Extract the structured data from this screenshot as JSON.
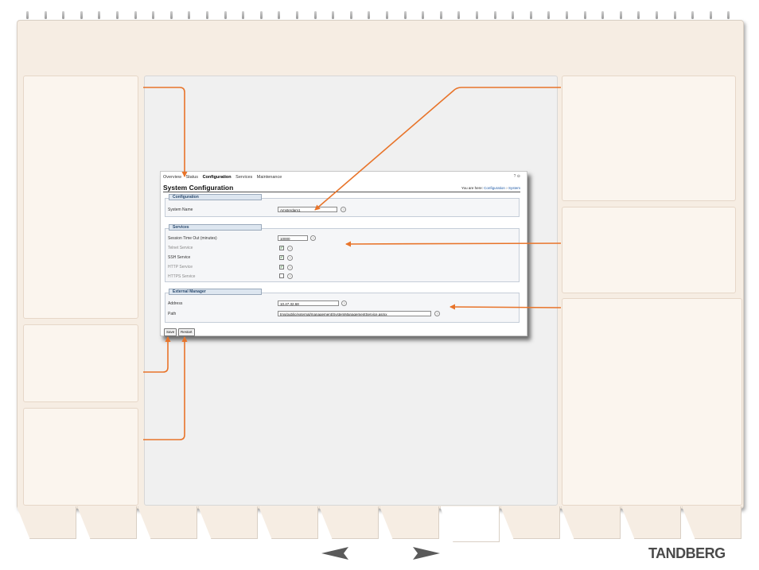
{
  "nav": {
    "items": [
      "Overview",
      "Status",
      "Configuration",
      "Services",
      "Maintenance"
    ],
    "active": "Configuration"
  },
  "page_title": "System Configuration",
  "breadcrumb": {
    "prefix": "You are here:",
    "path1": "Configuration",
    "separator": "›",
    "path2": "System"
  },
  "sections": {
    "configuration": {
      "title": "Configuration",
      "system_name_label": "System Name",
      "system_name_value": "Amsterdam1"
    },
    "services": {
      "title": "Services",
      "session_timeout_label": "Session Time Out (minutes)",
      "session_timeout_value": "10000",
      "telnet_label": "Telnet Service",
      "telnet_checked": true,
      "ssh_label": "SSH Service",
      "ssh_checked": true,
      "http_label": "HTTP Service",
      "http_checked": true,
      "https_label": "HTTPS Service",
      "https_checked": false
    },
    "external_manager": {
      "title": "External Manager",
      "address_label": "Address",
      "address_value": "10.47.32.68",
      "path_label": "Path",
      "path_value": "tms/public/external/management/SystemManagementService.asmx"
    }
  },
  "buttons": {
    "save": "Save",
    "restart": "Restart"
  },
  "brand": "TANDBERG",
  "colors": {
    "accent_orange": "#e8742a",
    "page_background": "#f6ede3",
    "link_blue": "#1f5aa6"
  },
  "icons": {
    "prev": "left-arrow-icon",
    "next": "right-arrow-icon",
    "help": "help-icon",
    "check": "checkmark-icon"
  }
}
